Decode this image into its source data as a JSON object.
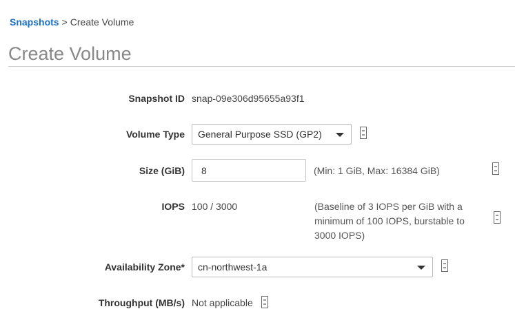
{
  "breadcrumb": {
    "link": "Snapshots",
    "separator": ">",
    "current": "Create Volume"
  },
  "page": {
    "title": "Create Volume"
  },
  "form": {
    "snapshot_id": {
      "label": "Snapshot ID",
      "value": "snap-09e306d95655a93f1"
    },
    "volume_type": {
      "label": "Volume Type",
      "selected": "General Purpose SSD (GP2)",
      "info_icon": "info-icon"
    },
    "size": {
      "label": "Size (GiB)",
      "value": "8",
      "hint": "(Min: 1 GiB, Max: 16384 GiB)",
      "info_icon": "info-icon"
    },
    "iops": {
      "label": "IOPS",
      "value": "100 / 3000",
      "hint": "(Baseline of 3 IOPS per GiB with a minimum of 100 IOPS, burstable to 3000 IOPS)",
      "info_icon": "info-icon"
    },
    "availability_zone": {
      "label": "Availability Zone*",
      "selected": "cn-northwest-1a",
      "info_icon": "info-icon"
    },
    "throughput": {
      "label": "Throughput (MB/s)",
      "value": "Not applicable",
      "info_icon": "info-icon"
    }
  },
  "colors": {
    "link": "#1a6fc4",
    "title": "#888888",
    "label": "#333333",
    "border": "#b8b8b8"
  }
}
